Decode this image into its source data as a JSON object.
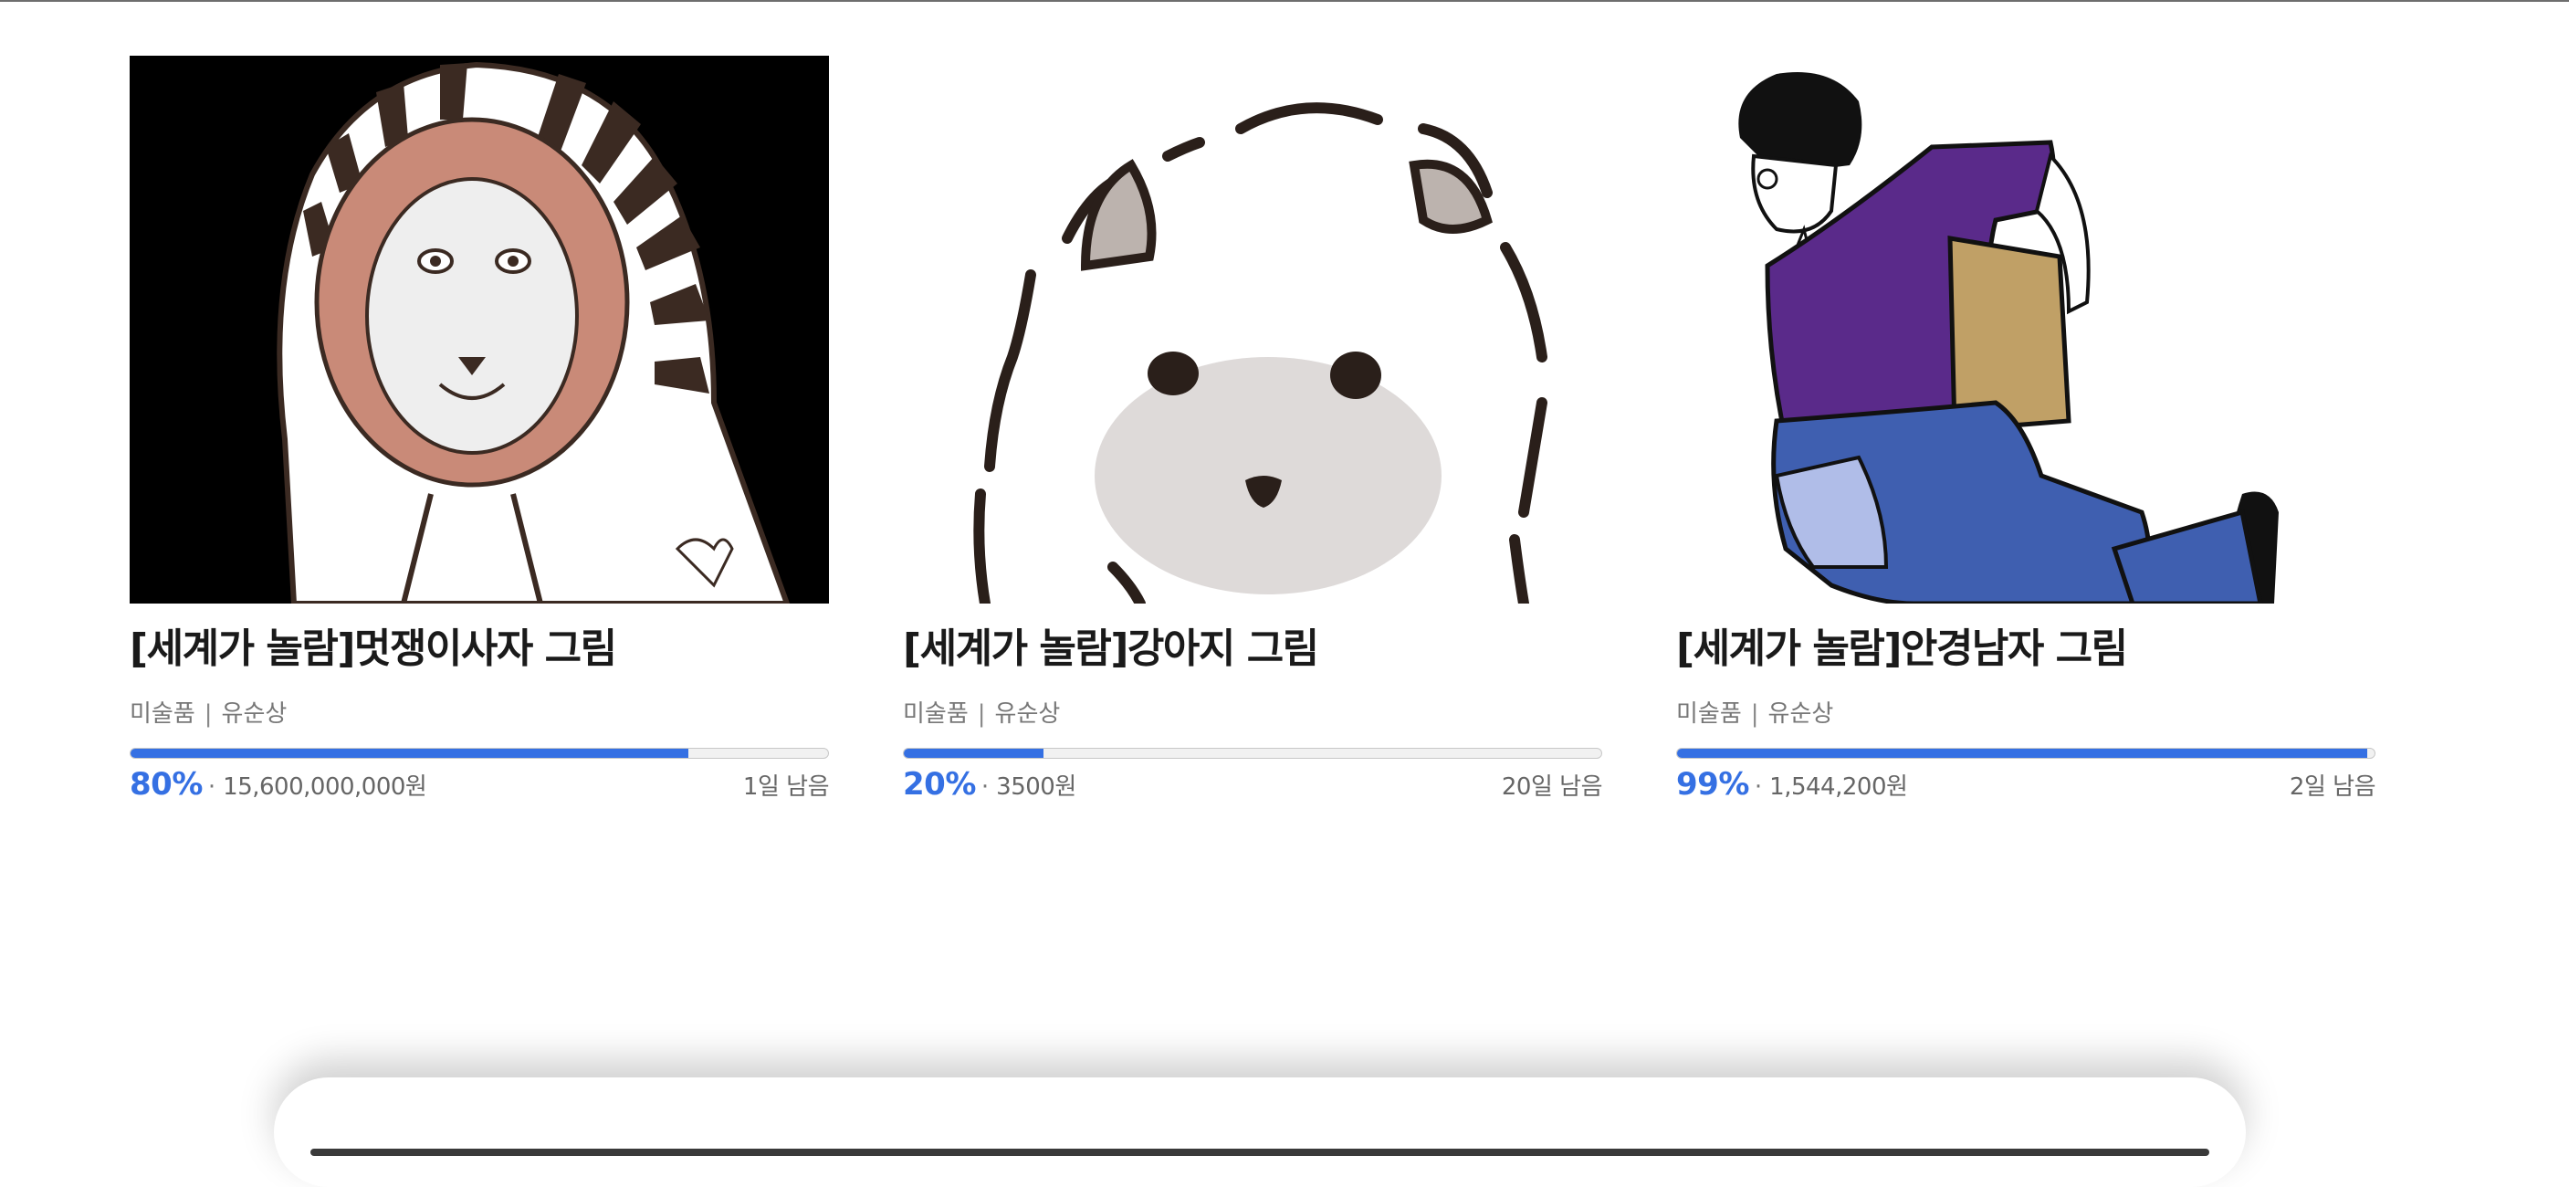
{
  "cards": [
    {
      "title": "[세계가 놀람]멋쟁이사자 그림",
      "category": "미술품",
      "separator": "|",
      "artist": "유순상",
      "progress_percent": 80,
      "percent_label": "80%",
      "amount": "15,600,000,000원",
      "remaining": "1일 남음",
      "image": "lion-drawing"
    },
    {
      "title": "[세계가 놀람]강아지 그림",
      "category": "미술품",
      "separator": "|",
      "artist": "유순상",
      "progress_percent": 20,
      "percent_label": "20%",
      "amount": "3500원",
      "remaining": "20일 남음",
      "image": "puppy-drawing"
    },
    {
      "title": "[세계가 놀람]안경남자 그림",
      "category": "미술품",
      "separator": "|",
      "artist": "유순상",
      "progress_percent": 99,
      "percent_label": "99%",
      "amount": "1,544,200원",
      "remaining": "2일 남음",
      "image": "glasses-man-drawing"
    }
  ],
  "colors": {
    "accent": "#3570e3",
    "title": "#1a1a1a",
    "meta": "#777777"
  }
}
